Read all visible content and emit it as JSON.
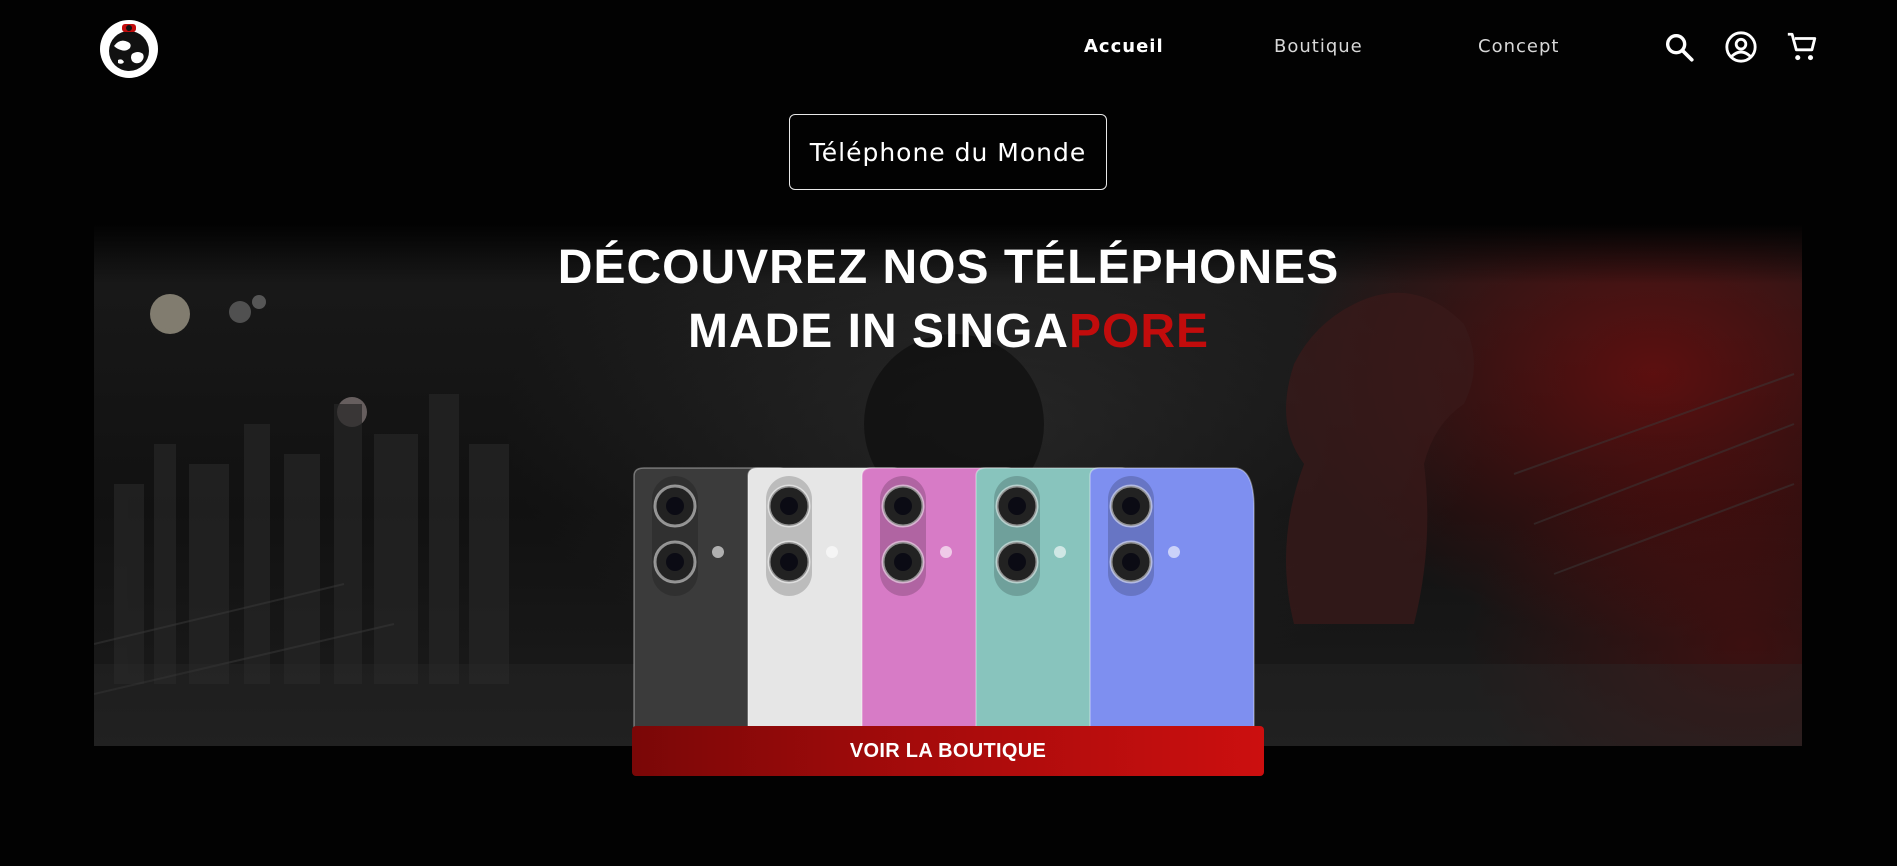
{
  "header": {
    "logo_icon": "globe-world-logo",
    "nav": [
      {
        "label": "Accueil",
        "active": true
      },
      {
        "label": "Boutique",
        "active": false
      },
      {
        "label": "Concept",
        "active": false
      }
    ],
    "icons": [
      "search-icon",
      "account-icon",
      "cart-icon"
    ]
  },
  "brand": {
    "name": "Téléphone du Monde"
  },
  "hero": {
    "headline_line1": "DÉCOUVREZ NOS TÉLÉPHONES",
    "headline_line2_prefix": "MADE IN SINGA",
    "headline_line2_accent": "PORE",
    "phone_colors": [
      "#3b3b3b",
      "#e6e6e6",
      "#d77bc6",
      "#88c4bd",
      "#7e8ff0"
    ],
    "cta_label": "VOIR LA BOUTIQUE"
  },
  "colors": {
    "accent": "#c20c0c",
    "background": "#020202",
    "cta_start": "#7a0707",
    "cta_end": "#cc0f0f"
  }
}
